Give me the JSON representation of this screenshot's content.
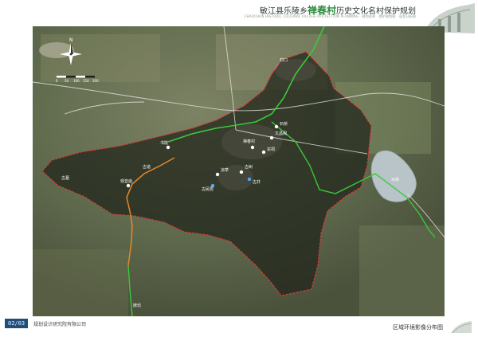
{
  "header": {
    "title_prefix": "敏江县乐陵乡",
    "title_highlight": "禅春村",
    "title_suffix": "历史文化名村保护规划",
    "subtitle": "CHAOCHUN HISTORIC CULTURAL VILLAGE PROTECTION PLANNING · 规划说明 · 保护规划图 · 现状分析图"
  },
  "map": {
    "compass_label": "N",
    "scale_labels": [
      "0",
      "50",
      "100",
      "150",
      "200"
    ],
    "labels": [
      "禅春村",
      "宗祠",
      "古树",
      "古井",
      "古民居",
      "书院",
      "文昌阁",
      "观音庙",
      "凉亭",
      "石桥",
      "古道",
      "水库",
      "村口",
      "古墓",
      "牌坊"
    ]
  },
  "footer": {
    "page_code": "02/03",
    "org_name": "规划设计研究院有限公司",
    "map_name": "区域环境影像分布图"
  },
  "colors": {
    "boundary": "#e23a3a",
    "green_line": "#3cc83c",
    "orange_route": "#e8872b",
    "code_bg": "#1e4f7a"
  }
}
